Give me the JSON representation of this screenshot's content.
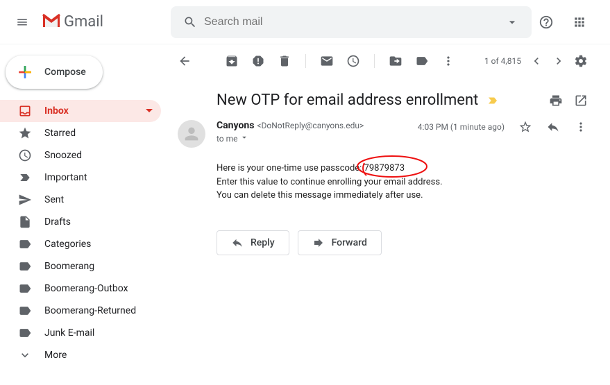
{
  "header": {
    "logo_text": "Gmail",
    "search_placeholder": "Search mail"
  },
  "compose_label": "Compose",
  "sidebar": {
    "items": [
      {
        "label": "Inbox"
      },
      {
        "label": "Starred"
      },
      {
        "label": "Snoozed"
      },
      {
        "label": "Important"
      },
      {
        "label": "Sent"
      },
      {
        "label": "Drafts"
      },
      {
        "label": "Categories"
      },
      {
        "label": "Boomerang"
      },
      {
        "label": "Boomerang-Outbox"
      },
      {
        "label": "Boomerang-Returned"
      },
      {
        "label": "Junk E-mail"
      },
      {
        "label": "More"
      }
    ]
  },
  "toolbar": {
    "pagination": "1 of 4,815"
  },
  "email": {
    "subject": "New OTP for email address enrollment",
    "sender_name": "Canyons",
    "sender_email": "<DoNotReply@canyons.edu>",
    "to_prefix": "to me",
    "time": "4:03 PM (1 minute ago)",
    "body_line1": "Here is your one-time use passcode: 79879873",
    "body_line2": "Enter this value to continue enrolling your email address.",
    "body_line3": "You can delete this message immediately after use.",
    "reply_label": "Reply",
    "forward_label": "Forward"
  }
}
